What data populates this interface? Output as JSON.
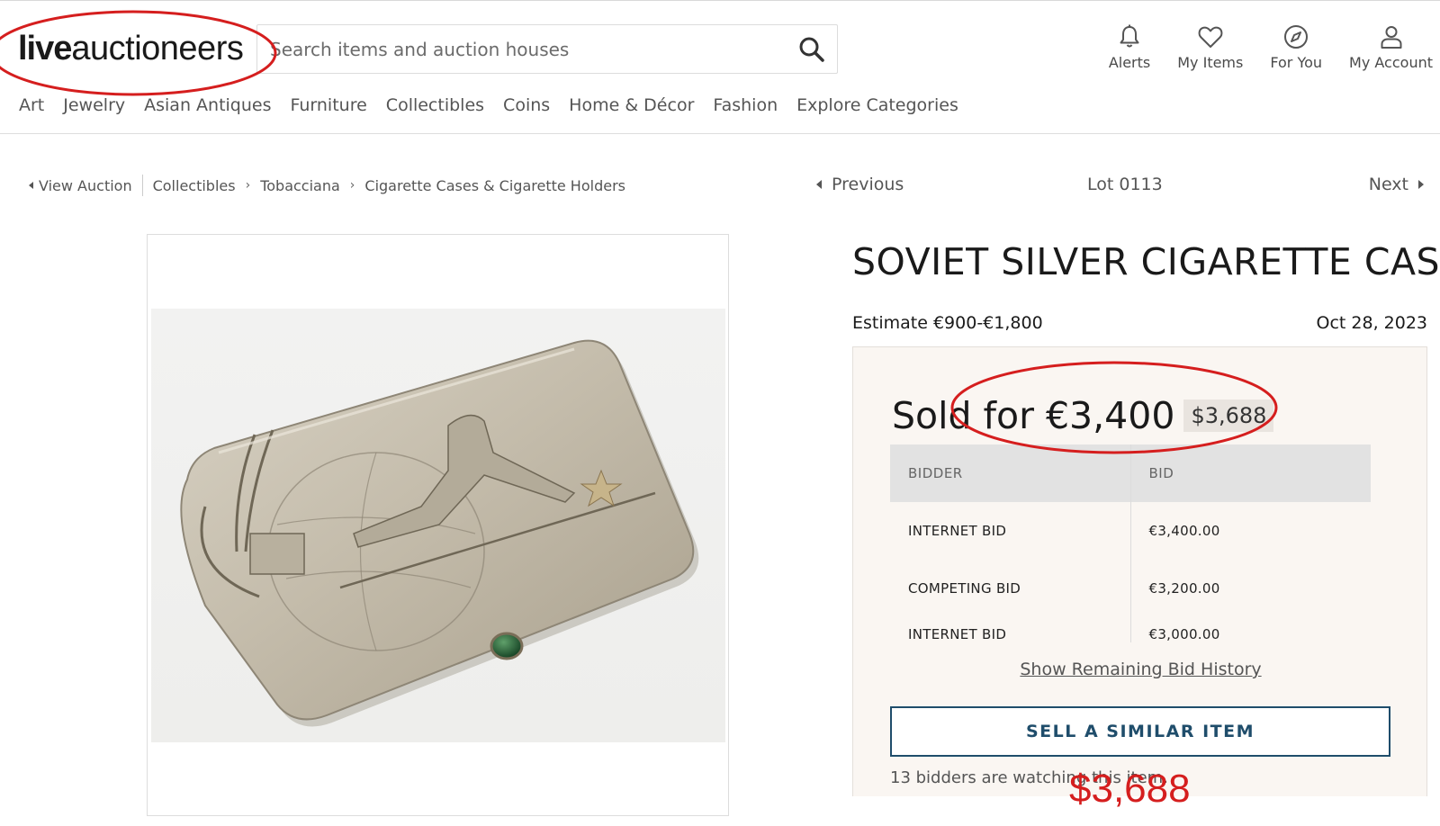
{
  "header": {
    "logo_live": "live",
    "logo_rest": "auctioneers",
    "search_placeholder": "Search items and auction houses",
    "actions": [
      {
        "label": "Alerts",
        "icon": "bell-icon"
      },
      {
        "label": "My Items",
        "icon": "heart-icon"
      },
      {
        "label": "For You",
        "icon": "compass-icon"
      },
      {
        "label": "My Account",
        "icon": "user-icon"
      }
    ]
  },
  "categories": [
    "Art",
    "Jewelry",
    "Asian Antiques",
    "Furniture",
    "Collectibles",
    "Coins",
    "Home & Décor",
    "Fashion",
    "Explore Categories"
  ],
  "breadcrumb": {
    "view_auction": "View Auction",
    "items": [
      "Collectibles",
      "Tobacciana",
      "Cigarette Cases & Cigarette Holders"
    ]
  },
  "lot_nav": {
    "previous": "Previous",
    "lot": "Lot 0113",
    "next": "Next"
  },
  "lot": {
    "title": "SOVIET SILVER CIGARETTE CASE",
    "estimate": "Estimate €900-€1,800",
    "date": "Oct 28, 2023",
    "sold_text": "Sold for €3,400",
    "usd_value": "$3,688"
  },
  "bid_history": {
    "headers": [
      "BIDDER",
      "BID"
    ],
    "rows": [
      {
        "bidder": "INTERNET BID",
        "bid": "€3,400.00"
      },
      {
        "bidder": "COMPETING BID",
        "bid": "€3,200.00"
      },
      {
        "bidder": "INTERNET BID",
        "bid": "€3,000.00"
      }
    ],
    "show_remaining": "Show Remaining Bid History"
  },
  "sell_button": "SELL A SIMILAR ITEM",
  "watching": "13 bidders are watching this item.",
  "annotation": {
    "price_text": "$3,688",
    "color": "#d51e1e"
  },
  "colors": {
    "accent": "#1f4d6b",
    "panel_bg": "#faf6f2",
    "annotation": "#d51e1e"
  }
}
